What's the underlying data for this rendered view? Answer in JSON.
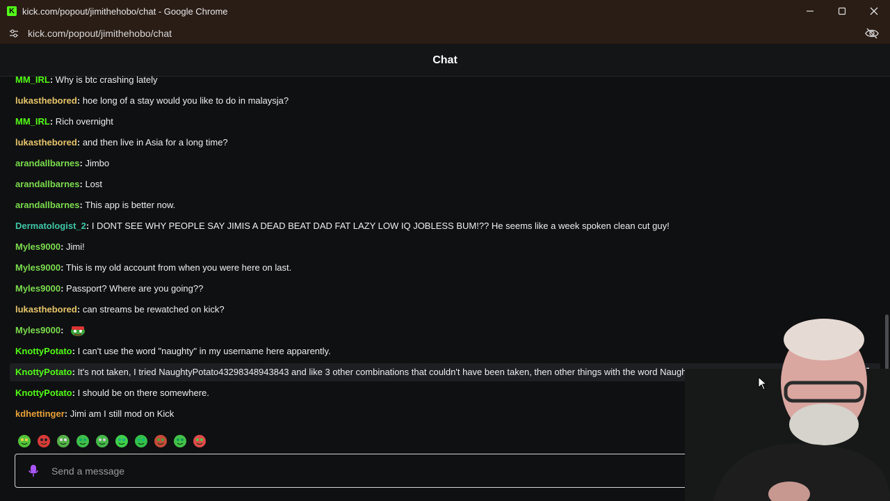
{
  "window": {
    "title": "kick.com/popout/jimithehobo/chat - Google Chrome",
    "favicon_letter": "K",
    "minimize_icon": "minimize-icon",
    "maximize_icon": "maximize-icon",
    "close_icon": "close-icon"
  },
  "address_bar": {
    "url": "kick.com/popout/jimithehobo/chat",
    "site_info_icon": "tune-icon",
    "privacy_icon": "eye-off-icon"
  },
  "chat": {
    "title": "Chat",
    "messages": [
      {
        "user": "MM_IRL",
        "color": "#53fc18",
        "text": " Why is btc crashing lately"
      },
      {
        "user": "lukasthebored",
        "color": "#e7c56a",
        "text": " hoe long of a stay would you like to do in malaysja?"
      },
      {
        "user": "MM_IRL",
        "color": "#53fc18",
        "text": " Rich overnight"
      },
      {
        "user": "lukasthebored",
        "color": "#e7c56a",
        "text": " and then live in Asia for a long time?"
      },
      {
        "user": "arandallbarnes",
        "color": "#7bdc4e",
        "text": " Jimbo"
      },
      {
        "user": "arandallbarnes",
        "color": "#7bdc4e",
        "text": " Lost"
      },
      {
        "user": "arandallbarnes",
        "color": "#7bdc4e",
        "text": " This app is better now."
      },
      {
        "user": "Dermatologist_2",
        "color": "#3fc7a7",
        "text": " I DONT SEE WHY PEOPLE SAY JIMIS A DEAD BEAT DAD FAT LAZY LOW IQ JOBLESS BUM!?? He seems like a week spoken clean cut guy!"
      },
      {
        "user": "Myles9000",
        "color": "#7bdc4e",
        "text": " Jimi!"
      },
      {
        "user": "Myles9000",
        "color": "#7bdc4e",
        "text": " This is my old account from when you were here on last."
      },
      {
        "user": "Myles9000",
        "color": "#7bdc4e",
        "text": " Passport? Where are you going??"
      },
      {
        "user": "lukasthebored",
        "color": "#e7c56a",
        "text": " can streams be rewatched on kick?"
      },
      {
        "user": "Myles9000",
        "color": "#7bdc4e",
        "text": " ",
        "emote": "pepe-emote"
      },
      {
        "user": "KnottyPotato",
        "color": "#53fc18",
        "text": " I can't use the word \"naughty\" in my username here apparently."
      },
      {
        "user": "KnottyPotato",
        "color": "#53fc18",
        "text": " It's not taken, I tried NaughtyPotato43298348943843 and like 3 other combinations that couldn't have been taken, then other things with the word Naughty",
        "highlighted": true
      },
      {
        "user": "KnottyPotato",
        "color": "#53fc18",
        "text": " I should be on there somewhere."
      },
      {
        "user": "kdhettinger",
        "color": "#e8a23a",
        "text": " Jimi am I still mod on Kick"
      }
    ],
    "emote_bar": [
      "angel-emote",
      "red-emote",
      "goggles-emote",
      "smile-emote",
      "jester-emote",
      "grin-emote",
      "blob-emote",
      "hat-emote",
      "happy-emote",
      "heart-emote"
    ],
    "input": {
      "placeholder": "Send a message",
      "mic_icon": "mic-icon"
    }
  }
}
